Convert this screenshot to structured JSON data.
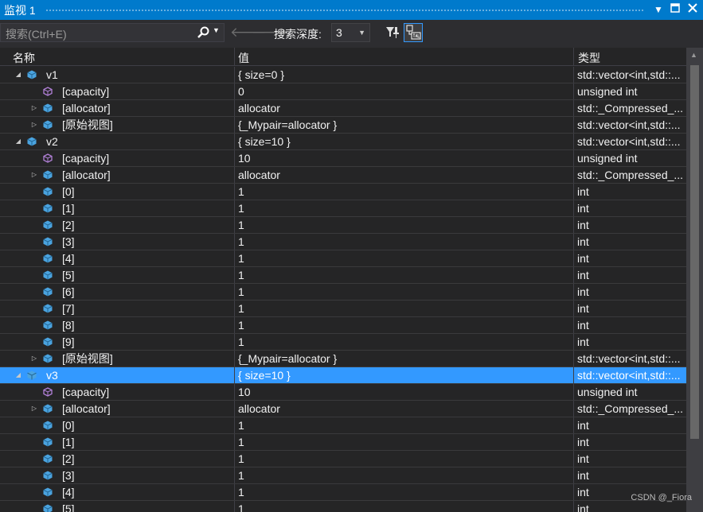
{
  "window": {
    "title": "监视 1",
    "dropdown_icon": "triangle-down",
    "maximize_icon": "square",
    "close_icon": "close-x"
  },
  "toolbar": {
    "search_placeholder": "搜索(Ctrl+E)",
    "depth_label": "搜索深度:",
    "depth_value": "3"
  },
  "columns": {
    "name": "名称",
    "value": "值",
    "type": "类型"
  },
  "rows": [
    {
      "indent": 0,
      "expander": "expanded",
      "icon": "variable",
      "name": "v1",
      "value": "{ size=0 }",
      "type": "std::vector<int,std::..."
    },
    {
      "indent": 1,
      "expander": "none",
      "icon": "field",
      "name": "[capacity]",
      "value": "0",
      "type": "unsigned int"
    },
    {
      "indent": 1,
      "expander": "collapsed",
      "icon": "variable",
      "name": "[allocator]",
      "value": "allocator",
      "type": "std::_Compressed_..."
    },
    {
      "indent": 1,
      "expander": "collapsed",
      "icon": "variable",
      "name": "[原始视图]",
      "value": "{_Mypair=allocator }",
      "type": "std::vector<int,std::..."
    },
    {
      "indent": 0,
      "expander": "expanded",
      "icon": "variable",
      "name": "v2",
      "value": "{ size=10 }",
      "type": "std::vector<int,std::..."
    },
    {
      "indent": 1,
      "expander": "none",
      "icon": "field",
      "name": "[capacity]",
      "value": "10",
      "type": "unsigned int"
    },
    {
      "indent": 1,
      "expander": "collapsed",
      "icon": "variable",
      "name": "[allocator]",
      "value": "allocator",
      "type": "std::_Compressed_..."
    },
    {
      "indent": 1,
      "expander": "none",
      "icon": "variable",
      "name": "[0]",
      "value": "1",
      "type": "int"
    },
    {
      "indent": 1,
      "expander": "none",
      "icon": "variable",
      "name": "[1]",
      "value": "1",
      "type": "int"
    },
    {
      "indent": 1,
      "expander": "none",
      "icon": "variable",
      "name": "[2]",
      "value": "1",
      "type": "int"
    },
    {
      "indent": 1,
      "expander": "none",
      "icon": "variable",
      "name": "[3]",
      "value": "1",
      "type": "int"
    },
    {
      "indent": 1,
      "expander": "none",
      "icon": "variable",
      "name": "[4]",
      "value": "1",
      "type": "int"
    },
    {
      "indent": 1,
      "expander": "none",
      "icon": "variable",
      "name": "[5]",
      "value": "1",
      "type": "int"
    },
    {
      "indent": 1,
      "expander": "none",
      "icon": "variable",
      "name": "[6]",
      "value": "1",
      "type": "int"
    },
    {
      "indent": 1,
      "expander": "none",
      "icon": "variable",
      "name": "[7]",
      "value": "1",
      "type": "int"
    },
    {
      "indent": 1,
      "expander": "none",
      "icon": "variable",
      "name": "[8]",
      "value": "1",
      "type": "int"
    },
    {
      "indent": 1,
      "expander": "none",
      "icon": "variable",
      "name": "[9]",
      "value": "1",
      "type": "int"
    },
    {
      "indent": 1,
      "expander": "collapsed",
      "icon": "variable",
      "name": "[原始视图]",
      "value": "{_Mypair=allocator }",
      "type": "std::vector<int,std::..."
    },
    {
      "indent": 0,
      "expander": "expanded",
      "icon": "variable",
      "name": "v3",
      "value": "{ size=10 }",
      "type": "std::vector<int,std::...",
      "selected": true
    },
    {
      "indent": 1,
      "expander": "none",
      "icon": "field",
      "name": "[capacity]",
      "value": "10",
      "type": "unsigned int"
    },
    {
      "indent": 1,
      "expander": "collapsed",
      "icon": "variable",
      "name": "[allocator]",
      "value": "allocator",
      "type": "std::_Compressed_..."
    },
    {
      "indent": 1,
      "expander": "none",
      "icon": "variable",
      "name": "[0]",
      "value": "1",
      "type": "int"
    },
    {
      "indent": 1,
      "expander": "none",
      "icon": "variable",
      "name": "[1]",
      "value": "1",
      "type": "int"
    },
    {
      "indent": 1,
      "expander": "none",
      "icon": "variable",
      "name": "[2]",
      "value": "1",
      "type": "int"
    },
    {
      "indent": 1,
      "expander": "none",
      "icon": "variable",
      "name": "[3]",
      "value": "1",
      "type": "int"
    },
    {
      "indent": 1,
      "expander": "none",
      "icon": "variable",
      "name": "[4]",
      "value": "1",
      "type": "int"
    },
    {
      "indent": 1,
      "expander": "none",
      "icon": "variable",
      "name": "[5]",
      "value": "1",
      "type": "int"
    }
  ],
  "watermark": "CSDN @_Fiora",
  "colors": {
    "accent": "#007acc",
    "selection": "#3399ff",
    "variable_icon": "#4aa3df",
    "field_icon": "#b180d7",
    "background": "#252526"
  }
}
